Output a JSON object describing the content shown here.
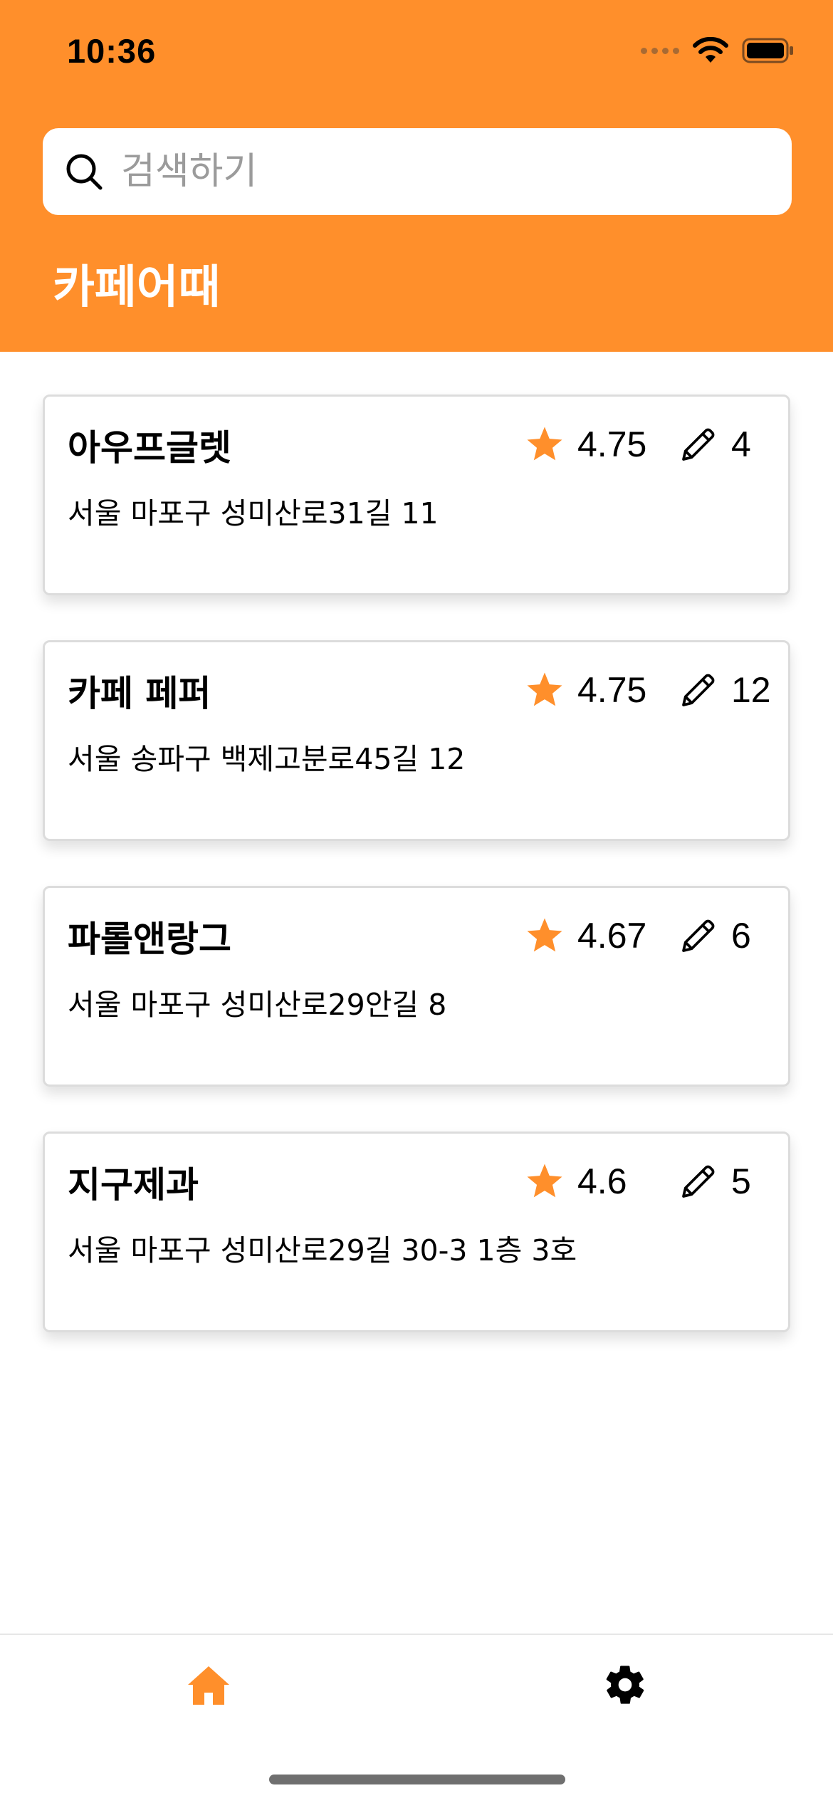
{
  "status_bar": {
    "time": "10:36",
    "wifi_icon": "wifi-icon",
    "battery_icon": "battery-icon"
  },
  "search": {
    "placeholder": "검색하기",
    "value": "",
    "icon": "search-icon"
  },
  "app_title": "카페어때",
  "colors": {
    "accent": "#ff8f2b",
    "star": "#ff8f2b",
    "tab_active": "#ff8f2b",
    "tab_inactive": "#000000"
  },
  "cafes": [
    {
      "name": "아우프글렛",
      "rating": "4.75",
      "reviews": "4",
      "address": "서울 마포구 성미산로31길 11"
    },
    {
      "name": "카페 페퍼",
      "rating": "4.75",
      "reviews": "12",
      "address": "서울 송파구 백제고분로45길 12"
    },
    {
      "name": "파롤앤랑그",
      "rating": "4.67",
      "reviews": "6",
      "address": "서울 마포구 성미산로29안길 8"
    },
    {
      "name": "지구제과",
      "rating": "4.6",
      "reviews": "5",
      "address": "서울 마포구 성미산로29길 30-3 1층 3호"
    }
  ],
  "tabs": [
    {
      "icon": "home-icon",
      "active": true
    },
    {
      "icon": "gear-icon",
      "active": false
    }
  ]
}
